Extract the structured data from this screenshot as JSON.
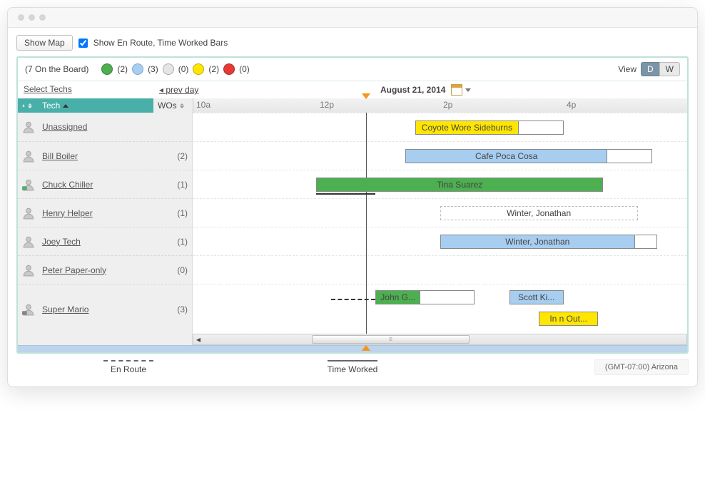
{
  "toolbar": {
    "show_map_label": "Show Map",
    "checkbox_label": "Show En Route, Time Worked Bars",
    "checkbox_checked": true
  },
  "status": {
    "board_summary": "(7 On the Board)",
    "counts": {
      "green": "(2)",
      "blue": "(3)",
      "grey": "(0)",
      "yellow": "(2)",
      "red": "(0)"
    },
    "view_label": "View",
    "view_options": {
      "day": "D",
      "week": "W"
    },
    "view_active": "D"
  },
  "nav": {
    "select_techs": "Select Techs",
    "prev_day": "prev day",
    "date": "August 21, 2014"
  },
  "columns": {
    "tech": "Tech",
    "wos": "WOs"
  },
  "time_ticks": [
    "10a",
    "12p",
    "2p",
    "4p"
  ],
  "techs": [
    {
      "name": "Unassigned",
      "wos": ""
    },
    {
      "name": "Bill Boiler",
      "wos": "(2)"
    },
    {
      "name": "Chuck Chiller",
      "wos": "(1)"
    },
    {
      "name": "Henry Helper",
      "wos": "(1)"
    },
    {
      "name": "Joey Tech",
      "wos": "(1)"
    },
    {
      "name": "Peter Paper-only",
      "wos": "(0)"
    },
    {
      "name": "Super Mario",
      "wos": "(3)"
    }
  ],
  "bars": {
    "unassigned": {
      "label": "Coyote Wore Sideburns"
    },
    "bill": {
      "label": "Cafe Poca Cosa"
    },
    "chuck": {
      "label": "Tina Suarez"
    },
    "henry": {
      "label": "Winter, Jonathan"
    },
    "joey": {
      "label": "Winter, Jonathan"
    },
    "mario1": {
      "label": "John G..."
    },
    "mario2": {
      "label": "Scott Ki..."
    },
    "mario3": {
      "label": "In n Out..."
    }
  },
  "legend": {
    "en_route": "En Route",
    "time_worked": "Time Worked",
    "timezone": "(GMT-07:00) Arizona"
  }
}
